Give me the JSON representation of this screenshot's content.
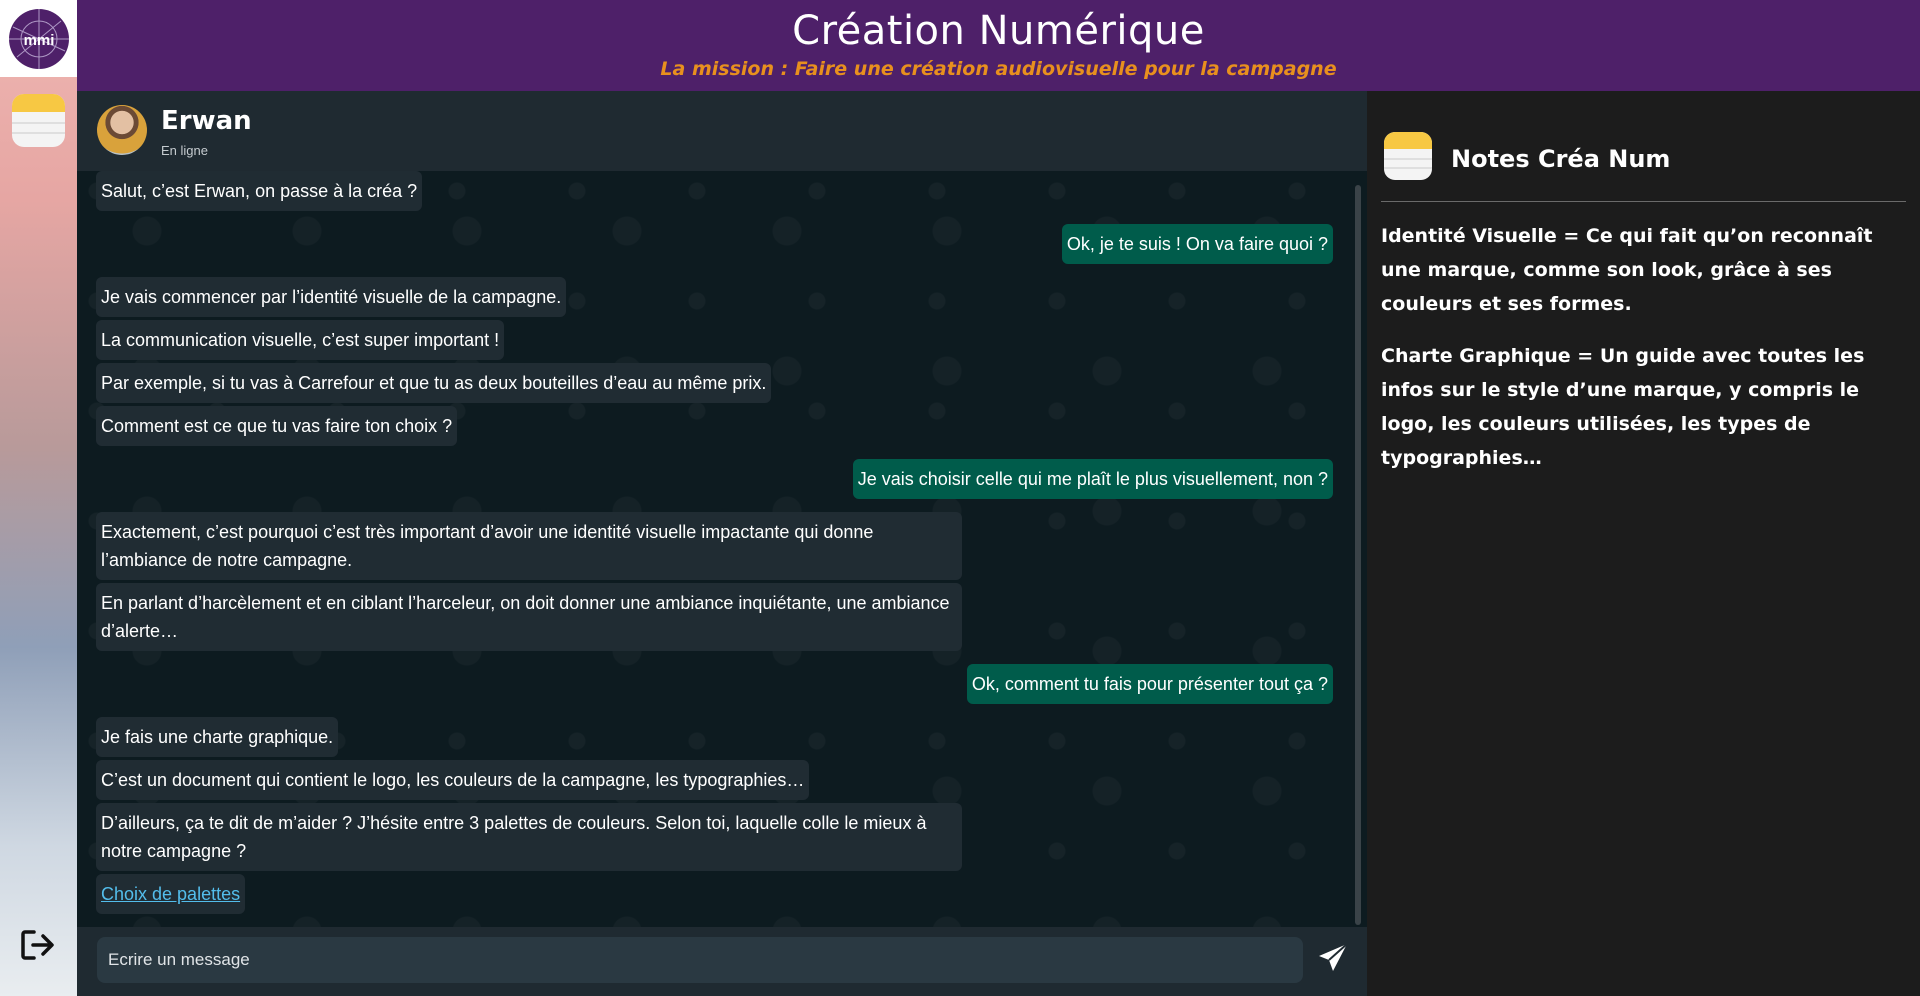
{
  "app": {
    "title": "Création Numérique",
    "subtitle": "La mission : Faire une création audiovisuelle pour la campagne",
    "logo_text": "mmi"
  },
  "dock": {
    "items": [
      {
        "icon": "mmi-logo-icon"
      },
      {
        "icon": "notes-app-icon"
      },
      {
        "icon": "logout-icon"
      }
    ]
  },
  "chat": {
    "contact": {
      "name": "Erwan",
      "status": "En ligne"
    },
    "messages": [
      {
        "direction": "in",
        "text": "Salut, c’est Erwan, on passe à la créa ?"
      },
      {
        "direction": "out",
        "text": "Ok, je te suis ! On va faire quoi ?"
      },
      {
        "direction": "in",
        "text": "Je vais commencer par l’identité visuelle de la campagne."
      },
      {
        "direction": "in",
        "text": "La communication visuelle, c’est super important !"
      },
      {
        "direction": "in",
        "text": "Par exemple, si tu vas à Carrefour et que tu as deux bouteilles d’eau au même prix."
      },
      {
        "direction": "in",
        "text": "Comment est ce que tu vas faire ton choix ?"
      },
      {
        "direction": "out",
        "text": "Je vais choisir celle qui me plaît le plus visuellement, non ?"
      },
      {
        "direction": "in",
        "text": "Exactement, c’est pourquoi c’est très important d’avoir une identité visuelle impactante qui donne l’ambiance de notre campagne."
      },
      {
        "direction": "in",
        "text": "En parlant d’harcèlement et en ciblant l’harceleur, on doit donner une ambiance inquiétante, une ambiance d’alerte…"
      },
      {
        "direction": "out",
        "text": "Ok, comment tu fais pour présenter tout ça ?"
      },
      {
        "direction": "in",
        "text": "Je fais une charte graphique."
      },
      {
        "direction": "in",
        "text": "C’est un document qui contient le logo, les couleurs de la campagne, les typographies…"
      },
      {
        "direction": "in",
        "text": "D’ailleurs, ça te dit de m’aider ? J’hésite entre 3 palettes de couleurs. Selon toi, laquelle colle le mieux à notre campagne ?"
      },
      {
        "direction": "link",
        "text": "Choix de palettes"
      }
    ],
    "composer": {
      "placeholder": "Ecrire un message",
      "send_icon": "send-icon"
    }
  },
  "notes": {
    "title": "Notes Créa Num",
    "entries": [
      "Identité Visuelle = Ce qui fait qu’on reconnaît une marque, comme son look, grâce à ses couleurs et ses formes.",
      "Charte Graphique = Un guide avec toutes les infos sur le style d’une marque, y compris le logo, les couleurs utilisées, les types de typographies…"
    ]
  },
  "colors": {
    "header_bg": "#4e2069",
    "subtitle": "#e8901e",
    "incoming_bubble": "#202c33",
    "outgoing_bubble": "#005c4b",
    "link": "#53bdeb"
  }
}
